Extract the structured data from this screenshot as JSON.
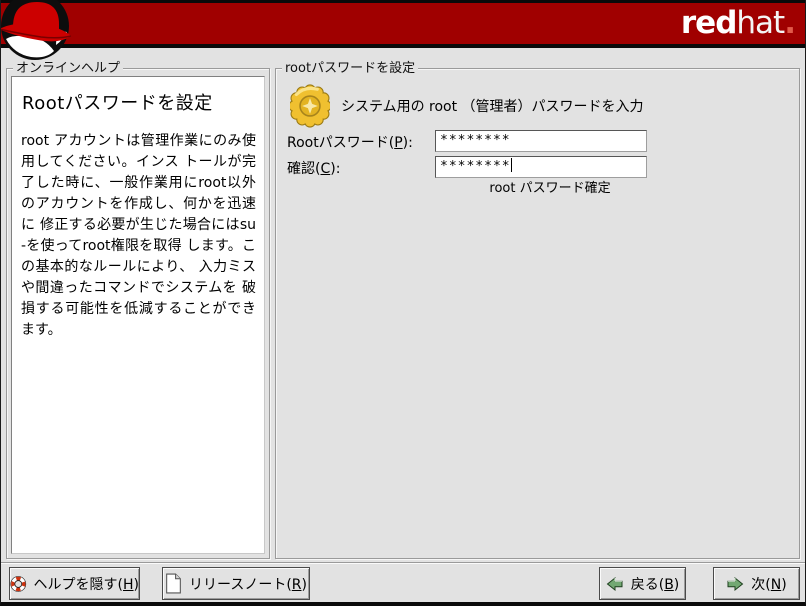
{
  "banner": {
    "brand_red": "red",
    "brand_hat": "hat",
    "brand_dot": "."
  },
  "help_panel": {
    "frame_label": "オンラインヘルプ",
    "title": "Rootパスワードを設定",
    "body": "root アカウントは管理作業にのみ使用してください。インス トールが完了した時に、一般作業用にroot以外のアカウントを作成し、何かを迅速に 修正する必要が生じた場合にはsu -を使ってroot権限を取得 します。この基本的なルールにより、 入力ミスや間違ったコマンドでシステムを 破損する可能性を低減することができます。"
  },
  "main_panel": {
    "frame_label": "rootパスワードを設定",
    "instruction": "システム用の root （管理者）パスワードを入力",
    "password_field": {
      "label_pre": "Rootパスワード(",
      "mnemonic": "P",
      "label_post": "):",
      "value": "********"
    },
    "confirm_field": {
      "label_pre": "確認(",
      "mnemonic": "C",
      "label_post": "):",
      "value": "********"
    },
    "status": "root パスワード確定"
  },
  "footer": {
    "hide_help": {
      "label_pre": "ヘルプを隠す(",
      "mnemonic": "H",
      "label_post": ")"
    },
    "release_notes": {
      "label_pre": "リリースノート(",
      "mnemonic": "R",
      "label_post": ")"
    },
    "back": {
      "label_pre": "戻る(",
      "mnemonic": "B",
      "label_post": ")"
    },
    "next": {
      "label_pre": "次(",
      "mnemonic": "N",
      "label_post": ")"
    }
  },
  "icons": {
    "logo": "redhat-shadowman",
    "instruction": "gold-badge",
    "hide_help": "lifebuoy",
    "release_notes": "document-page",
    "back": "green-arrow-left",
    "next": "green-arrow-right"
  },
  "colors": {
    "banner_red": "#a00000",
    "background": "#e2e2e2",
    "arrow_green": "#72a872",
    "badge_gold": "#f0c030",
    "lifebuoy_red": "#cc3311"
  }
}
